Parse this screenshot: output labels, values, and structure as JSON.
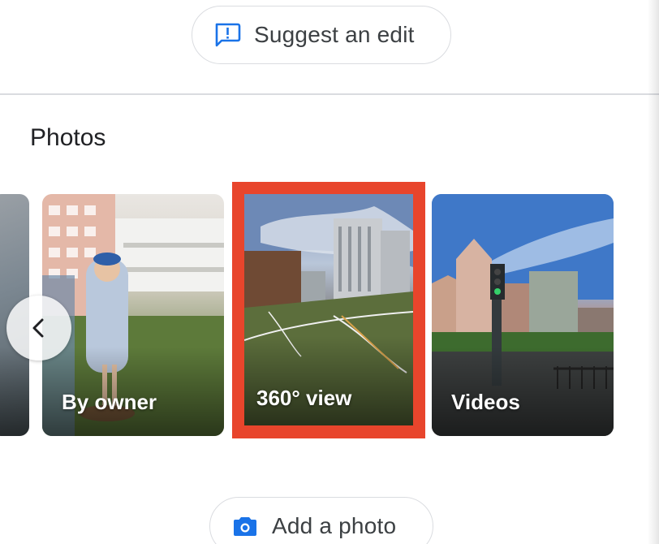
{
  "actions": {
    "suggest_edit_label": "Suggest an edit",
    "add_photo_label": "Add a photo"
  },
  "photos": {
    "title": "Photos",
    "cards": [
      {
        "label": ""
      },
      {
        "label": "By owner"
      },
      {
        "label": "360° view"
      },
      {
        "label": "Videos"
      }
    ],
    "highlight_color": "#e8452c"
  },
  "icons": {
    "suggest": "feedback-icon",
    "add_photo": "camera-icon",
    "prev": "chevron-left-icon"
  },
  "colors": {
    "accent": "#1a73e8",
    "pill_border": "#dadce0",
    "text": "#3c4043"
  }
}
